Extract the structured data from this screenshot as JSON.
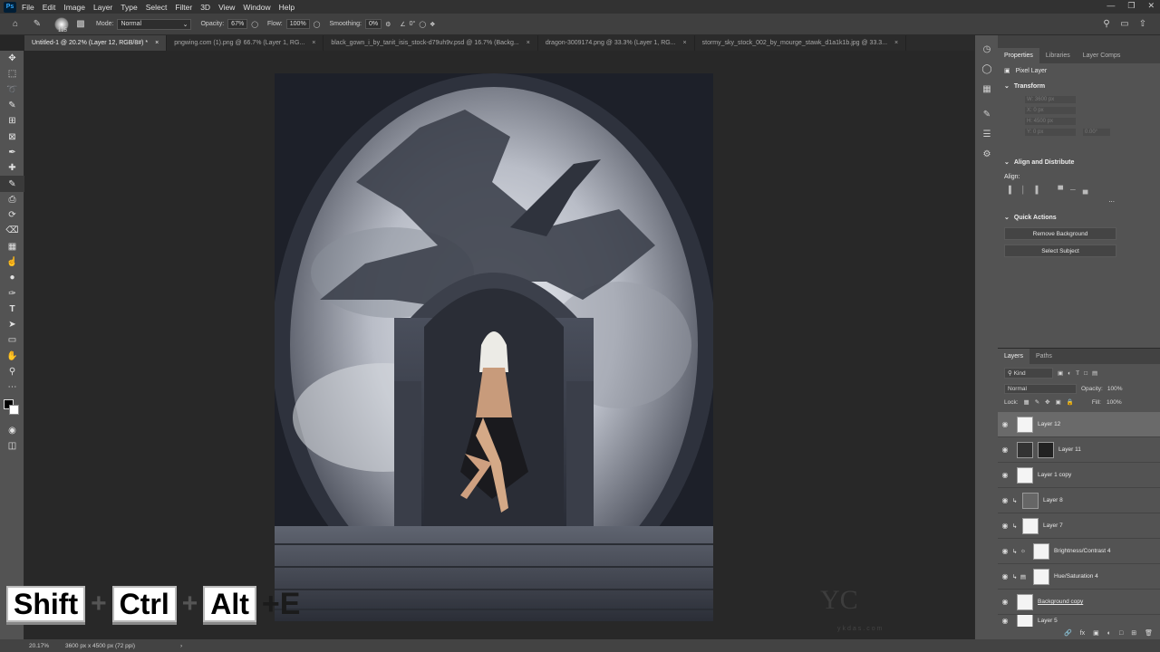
{
  "menu": [
    "File",
    "Edit",
    "Image",
    "Layer",
    "Type",
    "Select",
    "Filter",
    "3D",
    "View",
    "Window",
    "Help"
  ],
  "options": {
    "mode_label": "Mode:",
    "mode": "Normal",
    "opacity_label": "Opacity:",
    "opacity": "67%",
    "flow_label": "Flow:",
    "flow": "100%",
    "smoothing_label": "Smoothing:",
    "smoothing": "0%",
    "angle": "0°",
    "brush_size": "125"
  },
  "tabs": [
    "Untitled-1 @ 20.2% (Layer 12, RGB/8#) *",
    "pngwing.com (1).png @ 66.7% (Layer 1, RG...",
    "black_gown_i_by_tanit_isis_stock-d79uh9v.psd @ 16.7% (Backg...",
    "dragon-3009174.png @ 33.3% (Layer 1, RG...",
    "stormy_sky_stock_002_by_mourge_stawk_d1a1k1b.jpg @ 33.3..."
  ],
  "properties": {
    "tabs": [
      "Properties",
      "Libraries",
      "Layer Comps"
    ],
    "kind": "Pixel Layer",
    "transform": "Transform",
    "w": "W: 3600 px",
    "h": "H: 4500 px",
    "x": "X: 0 px",
    "y": "Y: 0 px",
    "angle": "0.00°",
    "align_title": "Align and Distribute",
    "align_label": "Align:",
    "quick_title": "Quick Actions",
    "remove_bg": "Remove Background",
    "select_subject": "Select Subject",
    "more": "..."
  },
  "layers": {
    "tabs": [
      "Layers",
      "Paths"
    ],
    "kind": "Kind",
    "blend": "Normal",
    "opacity_label": "Opacity:",
    "opacity": "100%",
    "lock_label": "Lock:",
    "fill_label": "Fill:",
    "fill": "100%",
    "items": [
      {
        "name": "Layer 12",
        "selected": true
      },
      {
        "name": "Layer 11"
      },
      {
        "name": "Layer 1 copy"
      },
      {
        "name": "Layer 8"
      },
      {
        "name": "Layer 7"
      },
      {
        "name": "Brightness/Contrast 4"
      },
      {
        "name": "Hue/Saturation 4"
      },
      {
        "name": "Background copy"
      },
      {
        "name": "Layer 5"
      }
    ]
  },
  "status": {
    "zoom": "20.17%",
    "size": "3600 px x 4500 px (72 ppi)"
  },
  "keys": [
    "Shift",
    "+",
    "Ctrl",
    "+",
    "Alt",
    "+E"
  ],
  "watermark": "ykdas.com",
  "colors": {
    "accent": "#31a8ff",
    "ui_bg": "#535353",
    "canvas_bg": "#282828"
  }
}
